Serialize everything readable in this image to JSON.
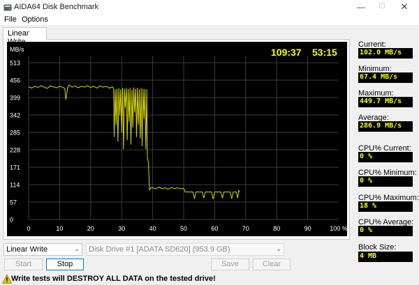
{
  "window": {
    "title": "AIDA64 Disk Benchmark",
    "minimize": "—",
    "maximize": "☐",
    "close": "✕"
  },
  "menu": {
    "file": "File",
    "options": "Options"
  },
  "tab": {
    "label": "Linear Write"
  },
  "chart_data": {
    "type": "line",
    "ylabel": "MB/s",
    "y_ticks": [
      0,
      57,
      114,
      171,
      228,
      285,
      342,
      399,
      456,
      513
    ],
    "ylim": [
      0,
      513
    ],
    "x_ticks": [
      0,
      10,
      20,
      30,
      40,
      50,
      60,
      70,
      80,
      90
    ],
    "x_tick_labels": [
      "0",
      "10",
      "20",
      "30",
      "40",
      "50",
      "60",
      "70",
      "80",
      "90",
      "100 %"
    ],
    "xlim": [
      0,
      100
    ],
    "grid": true,
    "timer_elapsed": "109:37",
    "timer_remaining": "53:15",
    "colors": {
      "background": "#000000",
      "grid": "#3b3b3b",
      "line": "#d8d800",
      "text": "#ffffff",
      "timer": "#ffff00"
    },
    "series": [
      {
        "points": [
          [
            0,
            434
          ],
          [
            1,
            430
          ],
          [
            2,
            436
          ],
          [
            3,
            432
          ],
          [
            4,
            438
          ],
          [
            5,
            433
          ],
          [
            6,
            429
          ],
          [
            7,
            437
          ],
          [
            8,
            434
          ],
          [
            9,
            431
          ],
          [
            10,
            436
          ],
          [
            11,
            433
          ],
          [
            11.7,
            428
          ],
          [
            12,
            392
          ],
          [
            12.6,
            431
          ],
          [
            13,
            440
          ],
          [
            14,
            433
          ],
          [
            15,
            437
          ],
          [
            16,
            431
          ],
          [
            17,
            436
          ],
          [
            18,
            433
          ],
          [
            19,
            438
          ],
          [
            20,
            432
          ],
          [
            21,
            436
          ],
          [
            22,
            430
          ],
          [
            23,
            437
          ],
          [
            24,
            433
          ],
          [
            25,
            436
          ],
          [
            26,
            430
          ],
          [
            27,
            434
          ],
          [
            27.4,
            430
          ],
          [
            27.6,
            270
          ],
          [
            27.9,
            425
          ],
          [
            28.2,
            310
          ],
          [
            28.5,
            428
          ],
          [
            28.8,
            255
          ],
          [
            29.1,
            430
          ],
          [
            29.4,
            340
          ],
          [
            29.7,
            426
          ],
          [
            30,
            285
          ],
          [
            30.3,
            431
          ],
          [
            30.6,
            230
          ],
          [
            30.9,
            428
          ],
          [
            31.2,
            365
          ],
          [
            31.5,
            430
          ],
          [
            31.8,
            260
          ],
          [
            32.1,
            427
          ],
          [
            32.4,
            320
          ],
          [
            32.7,
            430
          ],
          [
            33,
            245
          ],
          [
            33.3,
            425
          ],
          [
            33.6,
            300
          ],
          [
            33.9,
            432
          ],
          [
            34.2,
            350
          ],
          [
            34.5,
            428
          ],
          [
            34.8,
            270
          ],
          [
            35.1,
            431
          ],
          [
            35.4,
            310
          ],
          [
            35.7,
            426
          ],
          [
            36,
            265
          ],
          [
            36.3,
            430
          ],
          [
            36.6,
            240
          ],
          [
            36.9,
            428
          ],
          [
            37.2,
            330
          ],
          [
            37.5,
            427
          ],
          [
            37.8,
            230
          ],
          [
            38.1,
            426
          ],
          [
            38.3,
            200
          ],
          [
            38.6,
            190
          ],
          [
            39,
            95
          ],
          [
            39.3,
            103
          ],
          [
            40,
            104
          ],
          [
            41,
            100
          ],
          [
            42,
            106
          ],
          [
            43,
            101
          ],
          [
            44,
            104
          ],
          [
            45,
            99
          ],
          [
            46,
            105
          ],
          [
            47,
            101
          ],
          [
            48,
            104
          ],
          [
            49,
            100
          ],
          [
            50,
            102
          ],
          [
            50.5,
            90
          ],
          [
            53,
            90
          ],
          [
            53.5,
            68
          ],
          [
            54,
            90
          ],
          [
            56,
            90
          ],
          [
            56.5,
            70
          ],
          [
            57,
            90
          ],
          [
            59,
            90
          ],
          [
            59.5,
            67
          ],
          [
            60,
            90
          ],
          [
            62,
            90
          ],
          [
            62.5,
            70
          ],
          [
            63,
            90
          ],
          [
            65,
            90
          ],
          [
            65.5,
            68
          ],
          [
            66,
            90
          ],
          [
            67,
            90
          ],
          [
            67.4,
            70
          ],
          [
            67.8,
            95
          ],
          [
            68,
            90
          ]
        ]
      }
    ]
  },
  "stats": {
    "current_label": "Current:",
    "current_value": "102.0 MB/s",
    "minimum_label": "Minimum:",
    "minimum_value": "67.4 MB/s",
    "maximum_label": "Maximum:",
    "maximum_value": "449.7 MB/s",
    "average_label": "Average:",
    "average_value": "286.9 MB/s",
    "cpu_current_label": "CPU% Current:",
    "cpu_current_value": "0 %",
    "cpu_minimum_label": "CPU% Minimum:",
    "cpu_minimum_value": "0 %",
    "cpu_maximum_label": "CPU% Maximum:",
    "cpu_maximum_value": "18 %",
    "cpu_average_label": "CPU% Average:",
    "cpu_average_value": "0 %",
    "block_size_label": "Block Size:",
    "block_size_value": "4 MB"
  },
  "controls": {
    "test_select": "Linear Write",
    "drive_select": "Disk Drive #1  [ADATA   SD620]  (953.9 GB)",
    "start": "Start",
    "stop": "Stop",
    "save": "Save",
    "clear": "Clear"
  },
  "warning": {
    "text": "Write tests will DESTROY ALL DATA on the tested drive!"
  },
  "icons": {
    "app": "aida64-disk-icon",
    "warning": "warning-triangle-icon",
    "dropdown": "chevron-down-icon"
  }
}
